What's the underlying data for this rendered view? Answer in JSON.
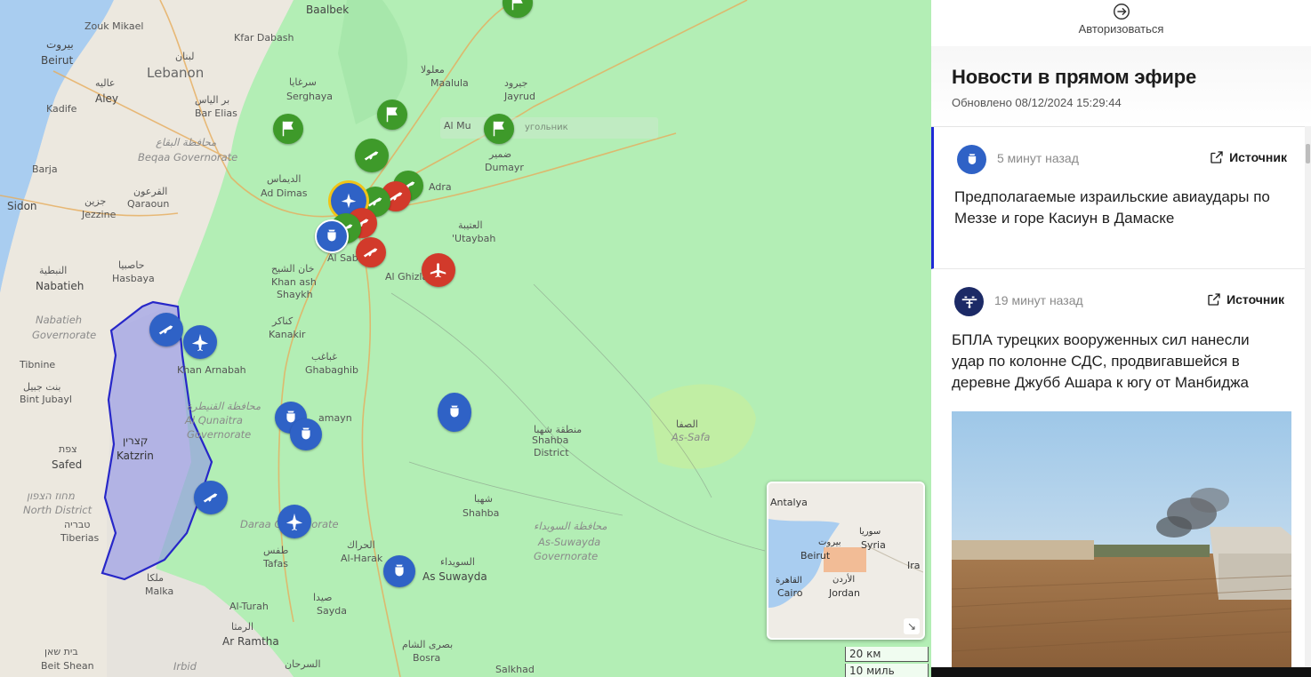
{
  "panel": {
    "login_label": "Авторизоваться",
    "title": "Новости в прямом эфире",
    "updated": "Обновлено 08/12/2024 15:29:44",
    "cards": [
      {
        "time": "5 минут назад",
        "source_label": "Источник",
        "icon": "bomb-icon",
        "text": "Предполагаемые израильские авиаудары по Меззе и горе Касиун в Дамаске"
      },
      {
        "time": "19 минут назад",
        "source_label": "Источник",
        "icon": "drone-icon",
        "text": "БПЛА турецких вооруженных сил нанесли удар по колонне СДС, продвигавшейся в деревне Джубб Ашара к югу от Манбиджа"
      }
    ]
  },
  "map": {
    "labels": {
      "baalbek": "Baalbek",
      "zouk": "Zouk Mikael",
      "kfar_dabash": "Kfar Dabash",
      "beirut_ar": "بيروت",
      "beirut": "Beirut",
      "lebanon": "Lebanon",
      "lebanon_ar": "لبنان",
      "aley": "Aley",
      "aley_ar": "عاليه",
      "bar_elias": "Bar Elias",
      "bar_elias_ar": "بر الياس",
      "kadife": "Kadife",
      "beqaa_ar": "محافظة البقاع",
      "beqaa": "Beqaa Governorate",
      "barja": "Barja",
      "sidon": "Sidon",
      "qaraoun": "Qaraoun",
      "qaraoun_ar": "القرعون",
      "jezzine": "Jezzine",
      "jezzine_ar": "جزين",
      "hasbaya": "Hasbaya",
      "hasbaya_ar": "حاصبيا",
      "nabatieh": "Nabatieh",
      "nabatieh_ar": "النبطية",
      "nabatieh_gov": "Nabatieh",
      "nabatieh_gov2": "Governorate",
      "tibnine": "Tibnine",
      "bint": "Bint Jubayl",
      "bint_ar": "بنت جبيل",
      "safed": "Safed",
      "safed_he": "צפת",
      "north_he": "מחוז הצפון",
      "north": "North District",
      "tiberias": "Tiberias",
      "tiberias_he": "טבריה",
      "katzrin_he": "קצרין",
      "katzrin": "Katzrin",
      "serghaya": "Serghaya",
      "serghaya_ar": "سرغايا",
      "maalula": "Maalula",
      "maalula_ar": "معلولا",
      "jayrud": "Jayrud",
      "jayrud_ar": "جيرود",
      "al_mu": "Al Mu",
      "search_hint": "угольник",
      "dumayr": "Dumayr",
      "dumayr_ar": "ضمير",
      "ad_dimas": "Ad Dimas",
      "ad_dimas_ar": "الديماس",
      "adra": "Adra",
      "utaybah": "'Utaybah",
      "utaybah_ar": "العتيبة",
      "al_sab": "Al Sab",
      "al_ghizl": "Al Ghizla",
      "khan_shaykh": "Khan ash",
      "khan_shaykh2": "Shaykh",
      "khan_ar": "خان الشيح",
      "kanakir": "Kanakir",
      "kanakir_ar": "كناكر",
      "ghabaghib": "Ghabaghib",
      "ghabaghib_ar": "غباغب",
      "khan_arnabah": "Khan Arnabah",
      "quneitra_ar": "محافظة القنيطرة",
      "quneitra": "Al Qunaitra",
      "quneitra2": "Governorate",
      "samayn": "amayn",
      "shahba_ar": "منطقة شهبا",
      "shahba_d": "Shahba",
      "shahba_d2": "District",
      "shahba_ar2": "شهبا",
      "shahba": "Shahba",
      "safa_ar": "الصفا",
      "safa": "As-Safa",
      "suwayda_gov_ar": "محافظة السويداء",
      "suwayda_gov": "As-Suwayda",
      "suwayda_gov2": "Governorate",
      "suwayda_ar": "السويداء",
      "suwayda": "As Suwayda",
      "daraa": "Daraa Governorate",
      "tafas": "Tafas",
      "tafas_ar": "طفس",
      "harak": "Al-Harak",
      "harak_ar": "الحراك",
      "malka": "Malka",
      "malka_ar": "ملكا",
      "al_turah": "Al-Turah",
      "ramtha": "Ar Ramtha",
      "ramtha_ar": "الرمثا",
      "irbid": "Irbid",
      "beit_shean": "Beit Shean",
      "beit_shean_he": "בית שאן",
      "sarhan_ar": "السرحان",
      "bosra": "Bosra",
      "bosra_ar": "بصرى الشام",
      "salkhad": "Salkhad",
      "sayda": "Sayda",
      "sayda_ar": "صيدا"
    },
    "minimap": {
      "antalya": "Antalya",
      "beirut": "Beirut",
      "beirut_ar": "بيروت",
      "syria": "Syria",
      "syria_ar": "سوريا",
      "iraq": "Ira",
      "cairo_ar": "القاهرة",
      "cairo": "Cairo",
      "jordan_ar": "الأردن",
      "jordan": "Jordan"
    },
    "scale": {
      "km": "20 км",
      "mi": "10 миль"
    },
    "markers": [
      {
        "kind": "flag",
        "color": "#3e9a2a"
      },
      {
        "kind": "flag",
        "color": "#3e9a2a"
      },
      {
        "kind": "flag",
        "color": "#3e9a2a"
      },
      {
        "kind": "rifle",
        "color": "#3e9a2a"
      },
      {
        "kind": "rifle",
        "color": "#d23a2b"
      },
      {
        "kind": "airplane",
        "color": "#d23a2b"
      },
      {
        "kind": "bomb",
        "color": "#2f62c6"
      },
      {
        "kind": "rifle",
        "color": "#2f62c6"
      },
      {
        "kind": "jet",
        "color": "#2f62c6"
      },
      {
        "kind": "bomb",
        "color": "#2f62c6"
      }
    ]
  }
}
